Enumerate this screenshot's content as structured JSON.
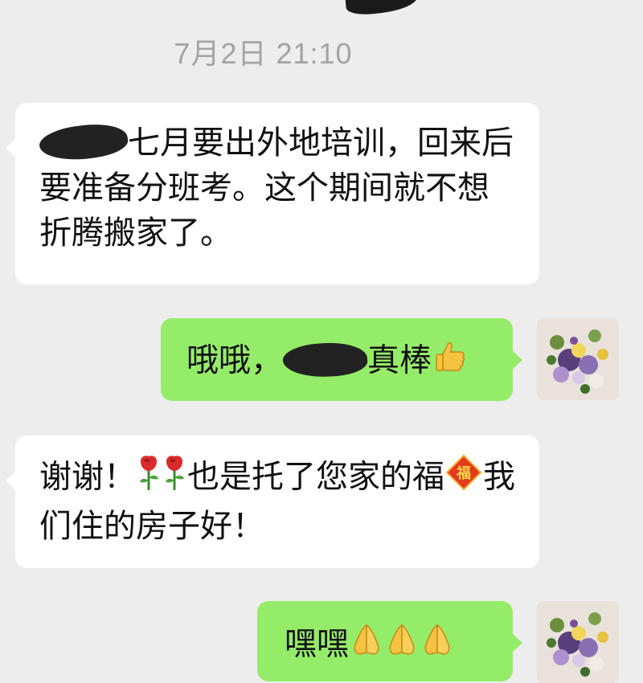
{
  "chat": {
    "timestamp": "7月2日 21:10",
    "messages": [
      {
        "sender": "other",
        "text_after_redaction": "七月要出外地培训，回来后要准备分班考。这个期间就不想折腾搬家了。"
      },
      {
        "sender": "self",
        "text_before_redaction": "哦哦，",
        "text_after_redaction": "真棒"
      },
      {
        "sender": "other",
        "text_part1": "谢谢！",
        "text_part2": "也是托了您家的福",
        "text_part3": "我们住的房子好！"
      },
      {
        "sender": "self",
        "text": "嘿嘿"
      }
    ]
  },
  "icons": {
    "thumbs_up": "thumbs-up-icon",
    "rose": "rose-icon",
    "fu": "fu-character-icon",
    "pray": "pray-hands-icon",
    "avatar": "flower-bouquet-avatar"
  },
  "colors": {
    "background": "#ededed",
    "incoming_bubble": "#ffffff",
    "outgoing_bubble": "#95ec69",
    "timestamp": "#a3a3a3"
  }
}
